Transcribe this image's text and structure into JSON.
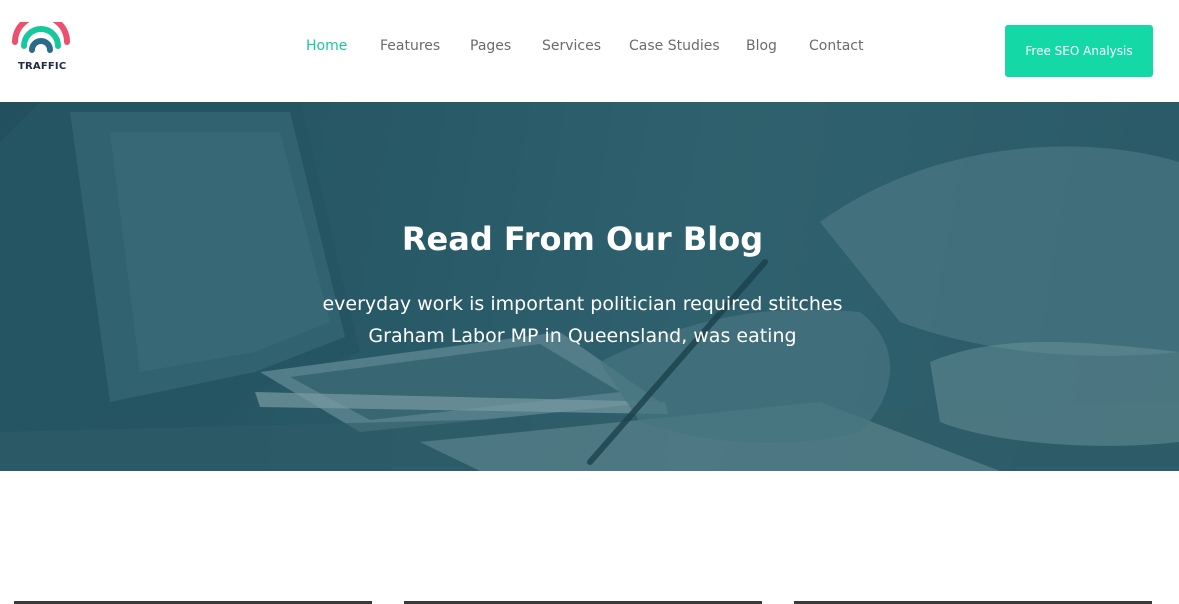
{
  "brand": {
    "name": "TRAFFIC",
    "colors": {
      "pink": "#ef4f6e",
      "teal": "#19c79e",
      "navy": "#1f2a44"
    }
  },
  "nav": {
    "items": [
      {
        "label": "Home",
        "active": true
      },
      {
        "label": "Features",
        "active": false
      },
      {
        "label": "Pages",
        "active": false
      },
      {
        "label": "Services",
        "active": false
      },
      {
        "label": "Case Studies",
        "active": false
      },
      {
        "label": "Blog",
        "active": false
      },
      {
        "label": "Contact",
        "active": false
      }
    ],
    "active_color": "#19c79e",
    "inactive_color": "#6b6b6b"
  },
  "cta": {
    "label": "Free SEO Analysis",
    "color": "#14d9a6"
  },
  "hero": {
    "title": "Read From Our Blog",
    "subtitle_line1": "everyday work is important politician required stitches",
    "subtitle_line2": "Graham Labor MP in Queensland, was eating",
    "overlay_color": "#2c5b68"
  }
}
